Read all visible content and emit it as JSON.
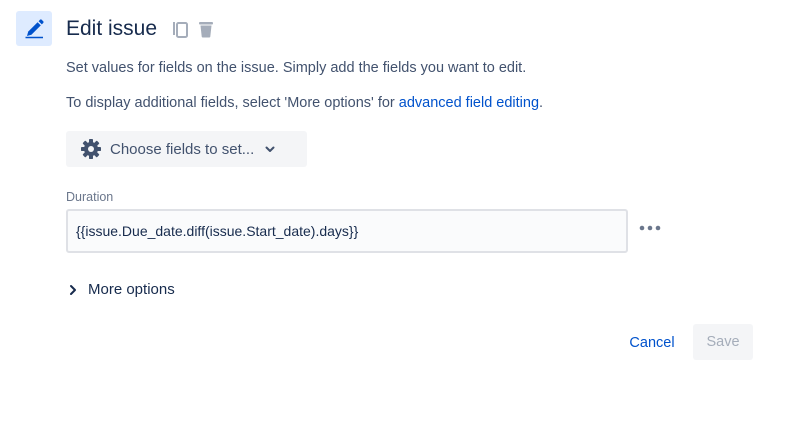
{
  "header": {
    "title": "Edit issue",
    "icon": "pencil-icon",
    "accent_color": "#0052cc"
  },
  "description": {
    "line1": "Set values for fields on the issue. Simply add the fields you want to edit.",
    "line2_prefix": "To display additional fields, select 'More options' for ",
    "line2_link": "advanced field editing",
    "line2_suffix": "."
  },
  "fields_picker": {
    "label": "Choose fields to set..."
  },
  "duration_field": {
    "label": "Duration",
    "value": "{{issue.Due_date.diff(issue.Start_date).days}}"
  },
  "more_options": {
    "label": "More options"
  },
  "footer": {
    "cancel_label": "Cancel",
    "save_label": "Save"
  }
}
